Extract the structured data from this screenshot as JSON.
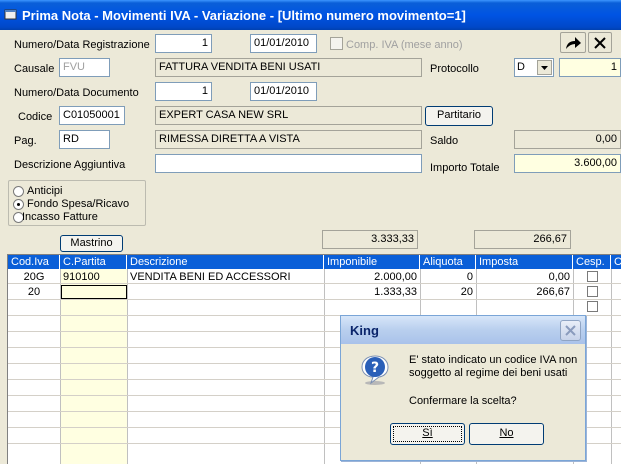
{
  "window": {
    "title": "Prima Nota - Movimenti IVA - Variazione - [Ultimo numero movimento=1]"
  },
  "form": {
    "reg_label": "Numero/Data Registrazione",
    "reg_number": "1",
    "reg_date": "01/01/2010",
    "comp_iva_label": "Comp. IVA (mese anno)",
    "causale_label": "Causale",
    "causale_code": "FVU",
    "causale_desc": "FATTURA VENDITA BENI USATI",
    "protocollo_label": "Protocollo",
    "protocollo_value": "D",
    "protocollo_number": "1",
    "doc_label": "Numero/Data Documento",
    "doc_number": "1",
    "doc_date": "01/01/2010",
    "codice_label": "Codice",
    "codice_value": "C01050001",
    "codice_desc": "EXPERT CASA NEW SRL",
    "partitario_label": "Partitario",
    "pag_label": "Pag.",
    "pag_code": "RD",
    "pag_desc": "RIMESSA DIRETTA A VISTA",
    "saldo_label": "Saldo",
    "saldo_value": "0,00",
    "desc_agg_label": "Descrizione Aggiuntiva",
    "desc_agg_value": "",
    "importo_label": "Importo Totale",
    "importo_value": "3.600,00"
  },
  "options": {
    "items": [
      "Anticipi",
      "Fondo Spesa/Ricavo",
      "Incasso Fatture"
    ],
    "selected": "Fondo Spesa/Ricavo"
  },
  "totals": {
    "mastrino_label": "Mastrino",
    "imponibile_total": "3.333,33",
    "imposta_total": "266,67"
  },
  "grid": {
    "columns": [
      "Cod.Iva",
      "C.Partita",
      "Descrizione",
      "Imponibile",
      "Aliquota",
      "Imposta",
      "Cesp.",
      "C"
    ],
    "rows": [
      {
        "cod_iva": "20G",
        "c_partita": "910100",
        "descrizione": "VENDITA BENI ED ACCESSORI",
        "imponibile": "2.000,00",
        "aliquota": "0",
        "imposta": "0,00"
      },
      {
        "cod_iva": "20",
        "c_partita": "",
        "descrizione": "",
        "imponibile": "1.333,33",
        "aliquota": "20",
        "imposta": "266,67"
      }
    ]
  },
  "dialog": {
    "title": "King",
    "message_line1": "E' stato indicato un codice IVA non",
    "message_line2": "soggetto al regime dei beni usati",
    "question": "Confermare la scelta?",
    "yes_label": "Sì",
    "no_label": "No"
  }
}
